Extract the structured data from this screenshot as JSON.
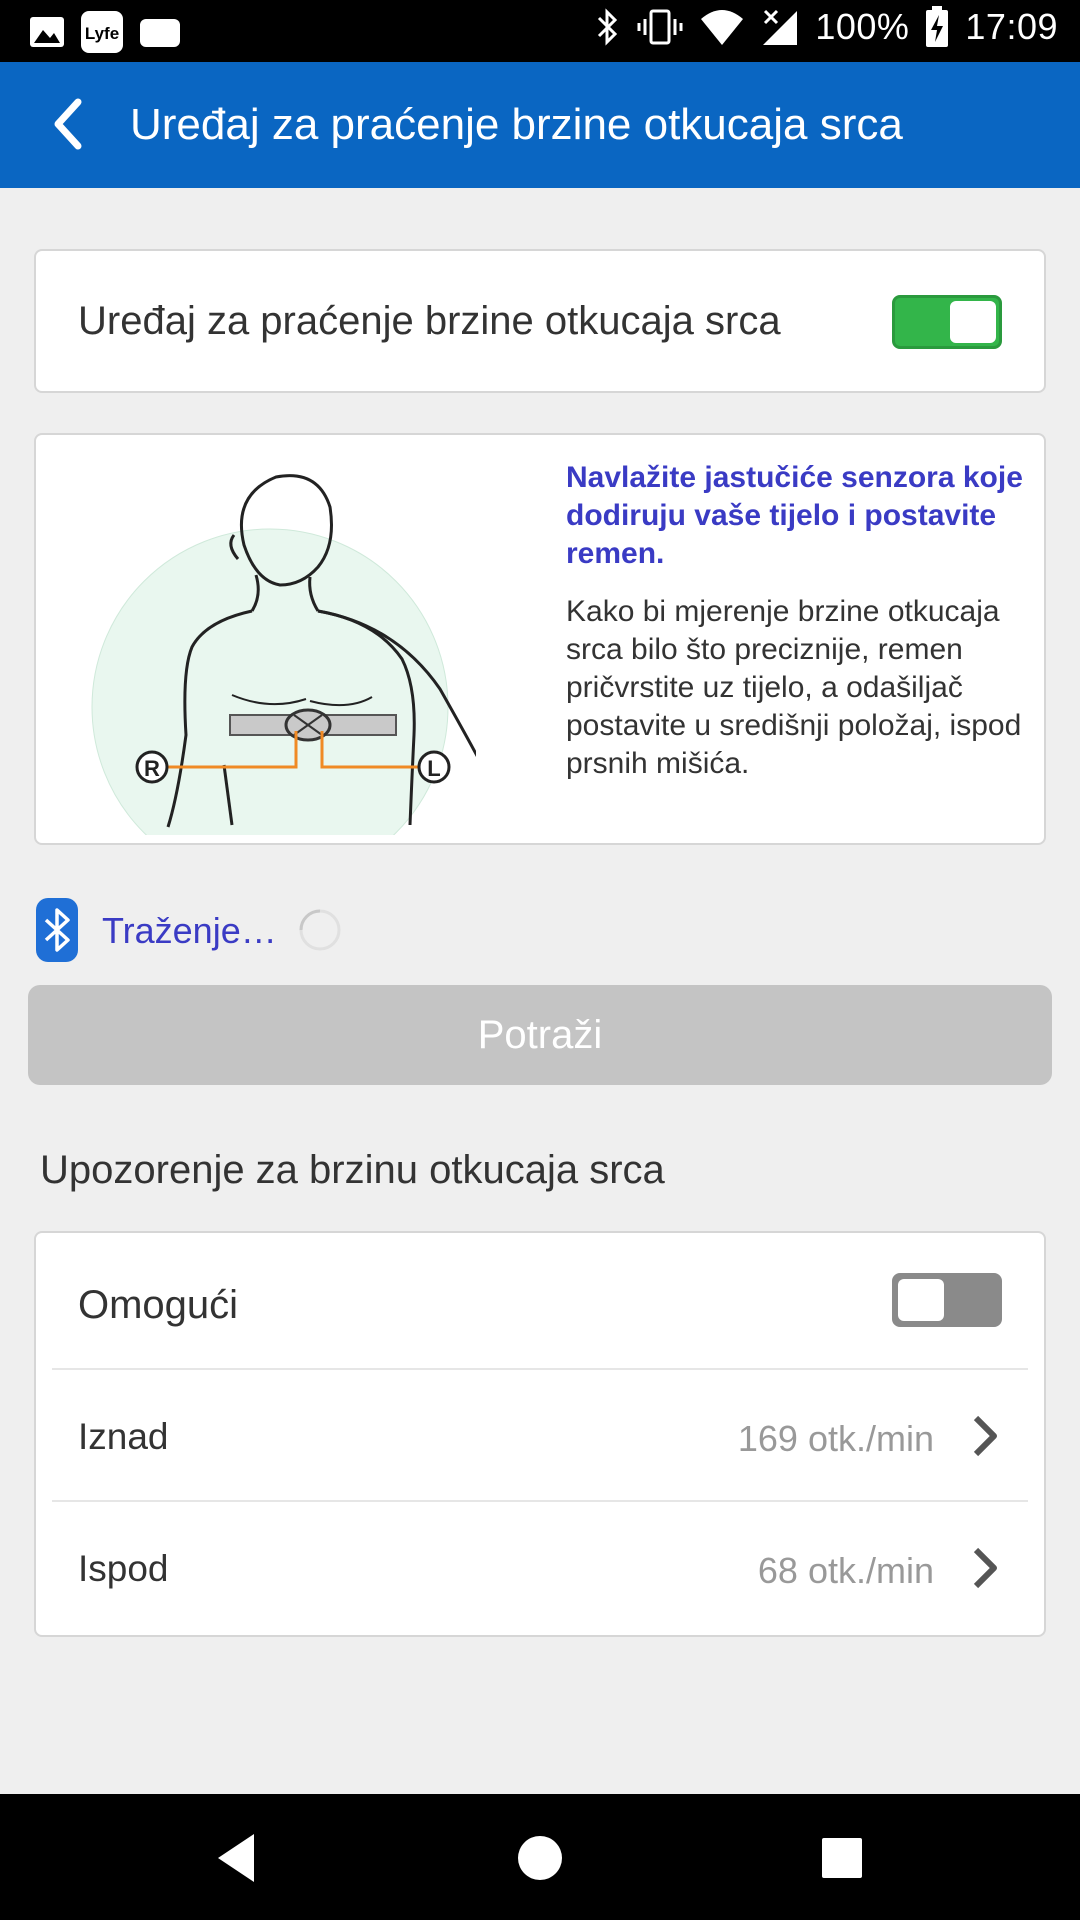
{
  "status_bar": {
    "battery": "100%",
    "time": "17:09",
    "icons": [
      "image-icon",
      "lyfe-app-icon",
      "tray-icon",
      "bluetooth-icon",
      "vibrate-icon",
      "wifi-icon",
      "signal-icon",
      "battery-charging-icon"
    ]
  },
  "app_bar": {
    "back_icon": "chevron-left-icon",
    "title": "Uređaj za praćenje brzine otkucaja srca",
    "background": "#0a66c2"
  },
  "device_card": {
    "label": "Uređaj za praćenje brzine otkucaja srca",
    "toggle_on": true,
    "toggle_color": "#33b54a"
  },
  "instructions": {
    "heading": "Navlažite jastučiće senzora koje dodiruju vaše tijelo i postavite remen.",
    "body": "Kako bi mjerenje brzine otkucaja srca bilo što preciznije, remen pričvrstite uz tijelo, a odašiljač postavite u središnji položaj, ispod prsnih mišića.",
    "illustration": {
      "right_marker": "R",
      "left_marker": "L"
    }
  },
  "bluetooth": {
    "icon": "bluetooth-icon",
    "status": "Traženje…"
  },
  "search_button": {
    "label": "Potraži"
  },
  "alert_section": {
    "title": "Upozorenje za brzinu otkucaja srca",
    "enable_label": "Omogući",
    "enable_on": false,
    "above_label": "Iznad",
    "above_value": "169 otk./min",
    "below_label": "Ispod",
    "below_value": "68 otk./min"
  },
  "nav_bar": {
    "icons": [
      "back-triangle-icon",
      "home-circle-icon",
      "recents-square-icon"
    ]
  }
}
